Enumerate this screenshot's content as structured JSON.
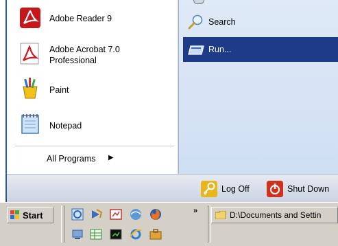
{
  "start_menu": {
    "pinned": [
      {
        "label": "Adobe Reader 9",
        "icon": "adobe-reader-icon"
      },
      {
        "label": "Adobe Acrobat 7.0 Professional",
        "icon": "adobe-acrobat-icon"
      },
      {
        "label": "Paint",
        "icon": "paint-icon"
      },
      {
        "label": "Notepad",
        "icon": "notepad-icon"
      }
    ],
    "all_programs": "All Programs",
    "right": [
      {
        "label": "Search",
        "icon": "search-icon"
      },
      {
        "label": "Run...",
        "icon": "run-icon"
      }
    ],
    "log_off": "Log Off",
    "shut_down": "Shut Down"
  },
  "taskbar": {
    "start_label": "Start",
    "overflow": "»",
    "task_label": "D:\\Documents and Settin"
  },
  "colors": {
    "selection": "#1e3b8a",
    "menu_edge": "#2a5b99"
  }
}
